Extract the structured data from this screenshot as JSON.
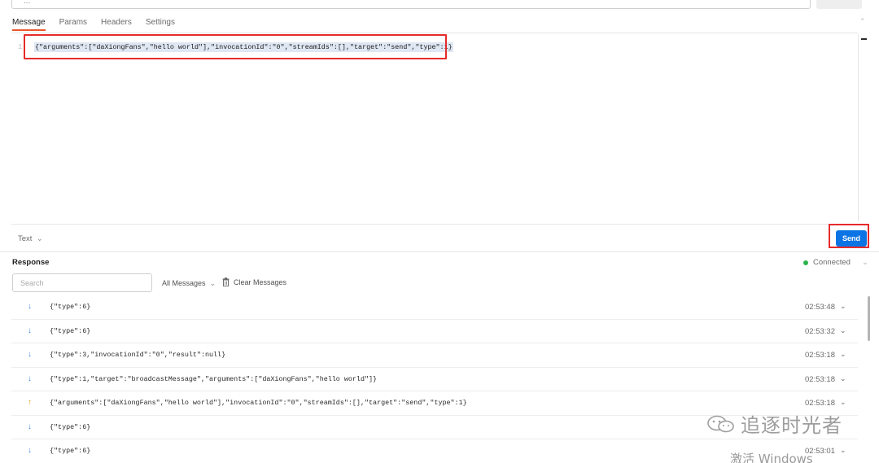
{
  "request": {
    "url_fragment": "..."
  },
  "tabs": [
    {
      "label": "Message",
      "active": true
    },
    {
      "label": "Params",
      "active": false
    },
    {
      "label": "Headers",
      "active": false
    },
    {
      "label": "Settings",
      "active": false
    }
  ],
  "editor": {
    "line_number": "1",
    "code": "{\"arguments\":[\"daXiongFans\",\"hello world\"],\"invocationId\":\"0\",\"streamIds\":[],\"target\":\"send\",\"type\":1}\u001e"
  },
  "footer": {
    "format_label": "Text",
    "send_label": "Send"
  },
  "response": {
    "title": "Response",
    "status": "Connected",
    "status_color": "#2bb24c",
    "search_placeholder": "Search",
    "filter_label": "All Messages",
    "clear_label": "Clear Messages",
    "messages": [
      {
        "direction": "down",
        "content": "{\"type\":6}\u001e",
        "time": "02:53:48"
      },
      {
        "direction": "down",
        "content": "{\"type\":6}\u001e",
        "time": "02:53:32"
      },
      {
        "direction": "down",
        "content": "{\"type\":3,\"invocationId\":\"0\",\"result\":null}\u001e",
        "time": "02:53:18"
      },
      {
        "direction": "down",
        "content": "{\"type\":1,\"target\":\"broadcastMessage\",\"arguments\":[\"daXiongFans\",\"hello world\"]}\u001e",
        "time": "02:53:18"
      },
      {
        "direction": "up",
        "content": "{\"arguments\":[\"daXiongFans\",\"hello world\"],\"invocationId\":\"0\",\"streamIds\":[],\"target\":\"send\",\"type\":1}\u001e",
        "time": "02:53:18"
      },
      {
        "direction": "down",
        "content": "{\"type\":6}\u001e",
        "time": ""
      },
      {
        "direction": "down",
        "content": "{\"type\":6}\u001e",
        "time": "02:53:01"
      }
    ]
  },
  "colors": {
    "accent_tab": "#e8582b",
    "send_button": "#0b74e5",
    "highlight_box": "#e52b2b",
    "incoming_arrow": "#3d8be0",
    "outgoing_arrow": "#e8a32b"
  },
  "overlay": {
    "watermark_text": "追逐时光者",
    "activate_text": "激活 Windows"
  }
}
